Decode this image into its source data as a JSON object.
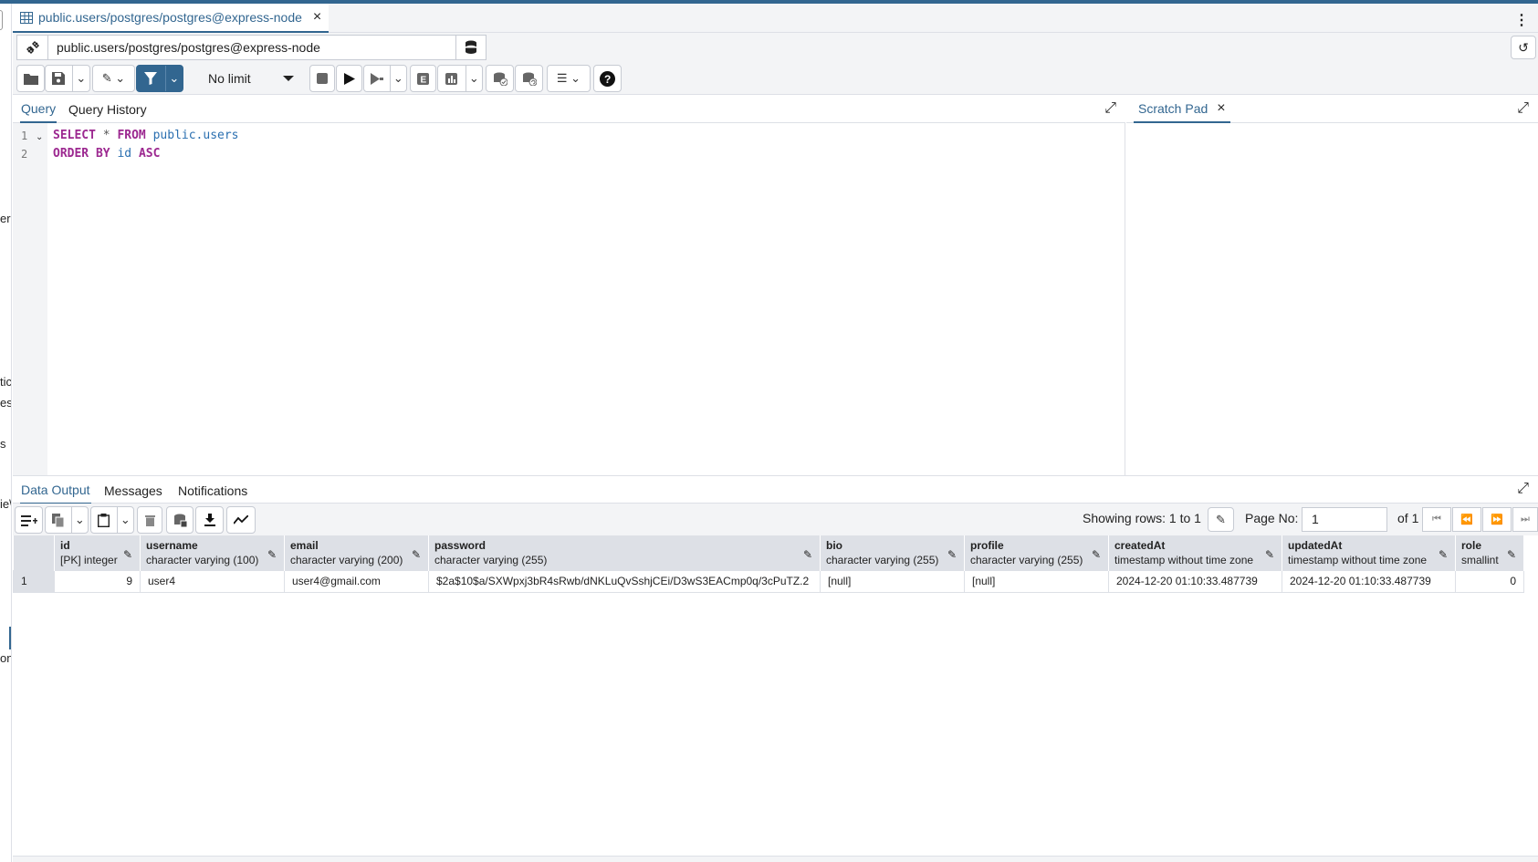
{
  "tab": {
    "title": "public.users/postgres/postgres@express-node",
    "close": "×"
  },
  "connection": {
    "value": "public.users/postgres/postgres@express-node"
  },
  "toolbar": {
    "limit": "No limit"
  },
  "query_tabs": {
    "query": "Query",
    "history": "Query History"
  },
  "scratch": {
    "title": "Scratch Pad",
    "close": "×"
  },
  "editor": {
    "line1": {
      "num": "1",
      "kw1": "SELECT",
      "star": " * ",
      "kw2": "FROM",
      "ident": " public.users"
    },
    "line2": {
      "num": "2",
      "kw1": "ORDER BY",
      "ident": " id ",
      "kw2": "ASC"
    }
  },
  "output_tabs": {
    "data": "Data Output",
    "messages": "Messages",
    "notifications": "Notifications"
  },
  "pagination": {
    "showing": "Showing rows: 1 to 1",
    "page_label": "Page No:",
    "page_value": "1",
    "of": "of 1"
  },
  "sidebar_fragments": [
    "er",
    "tic",
    "es",
    "s",
    "ie\\",
    "on"
  ],
  "columns": [
    {
      "name": "id",
      "type": "[PK] integer"
    },
    {
      "name": "username",
      "type": "character varying (100)"
    },
    {
      "name": "email",
      "type": "character varying (200)"
    },
    {
      "name": "password",
      "type": "character varying (255)"
    },
    {
      "name": "bio",
      "type": "character varying (255)"
    },
    {
      "name": "profile",
      "type": "character varying (255)"
    },
    {
      "name": "createdAt",
      "type": "timestamp without time zone"
    },
    {
      "name": "updatedAt",
      "type": "timestamp without time zone"
    },
    {
      "name": "role",
      "type": "smallint"
    }
  ],
  "rows": [
    {
      "rownum": "1",
      "id": "9",
      "username": "user4",
      "email": "user4@gmail.com",
      "password": "$2a$10$a/SXWpxj3bR4sRwb/dNKLuQvSshjCEi/D3wS3EACmp0q/3cPuTZ.2",
      "bio": "[null]",
      "profile": "[null]",
      "createdAt": "2024-12-20 01:10:33.487739",
      "updatedAt": "2024-12-20 01:10:33.487739",
      "role": "0"
    }
  ],
  "colors": {
    "accent": "#326690",
    "keyword": "#9c2890",
    "identifier": "#2a6fb0",
    "header_bg": "#dde0e6"
  }
}
